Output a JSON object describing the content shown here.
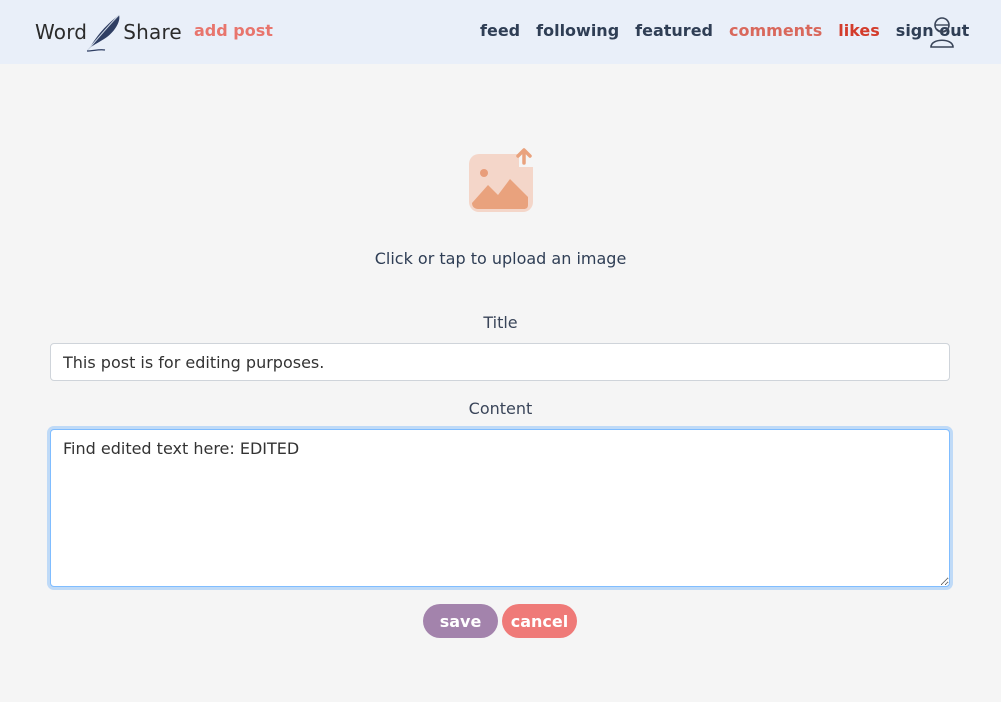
{
  "navbar": {
    "brand_left": "Word",
    "brand_right": "Share",
    "add_post": "add post",
    "links": [
      {
        "label": "feed"
      },
      {
        "label": "following"
      },
      {
        "label": "featured"
      },
      {
        "label": "comments"
      },
      {
        "label": "likes"
      },
      {
        "label": "sign out"
      }
    ],
    "avatar_icon": "user-avatar-icon"
  },
  "upload": {
    "icon": "image-upload-icon",
    "text": "Click or tap to upload an image"
  },
  "form": {
    "title_label": "Title",
    "title_value": "This post is for editing purposes.",
    "content_label": "Content",
    "content_value": "Find edited text here: EDITED",
    "save_label": "save",
    "cancel_label": "cancel"
  },
  "colors": {
    "navbar_bg": "#e9eff9",
    "page_bg": "#f5f5f5",
    "accent_add_post": "#e8756d",
    "comments": "#d9685c",
    "likes": "#d33c2c",
    "save_button": "#a383ac",
    "cancel_button": "#ef7a78"
  }
}
